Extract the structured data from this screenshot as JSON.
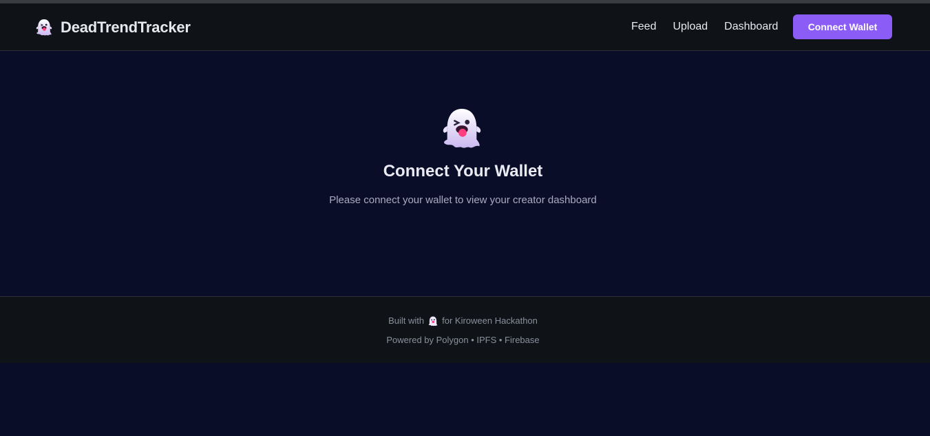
{
  "app": {
    "brand_name": "DeadTrendTracker",
    "brand_icon": "ghost-icon",
    "accent_color": "#8b5cf6"
  },
  "nav": {
    "links": [
      {
        "label": "Feed"
      },
      {
        "label": "Upload"
      },
      {
        "label": "Dashboard"
      }
    ],
    "connect_label": "Connect Wallet"
  },
  "main": {
    "icon": "ghost-icon",
    "title": "Connect Your Wallet",
    "subtitle": "Please connect your wallet to view your creator dashboard"
  },
  "footer": {
    "built_prefix": "Built with",
    "built_suffix": "for Kiroween Hackathon",
    "powered": "Powered by Polygon • IPFS • Firebase"
  }
}
